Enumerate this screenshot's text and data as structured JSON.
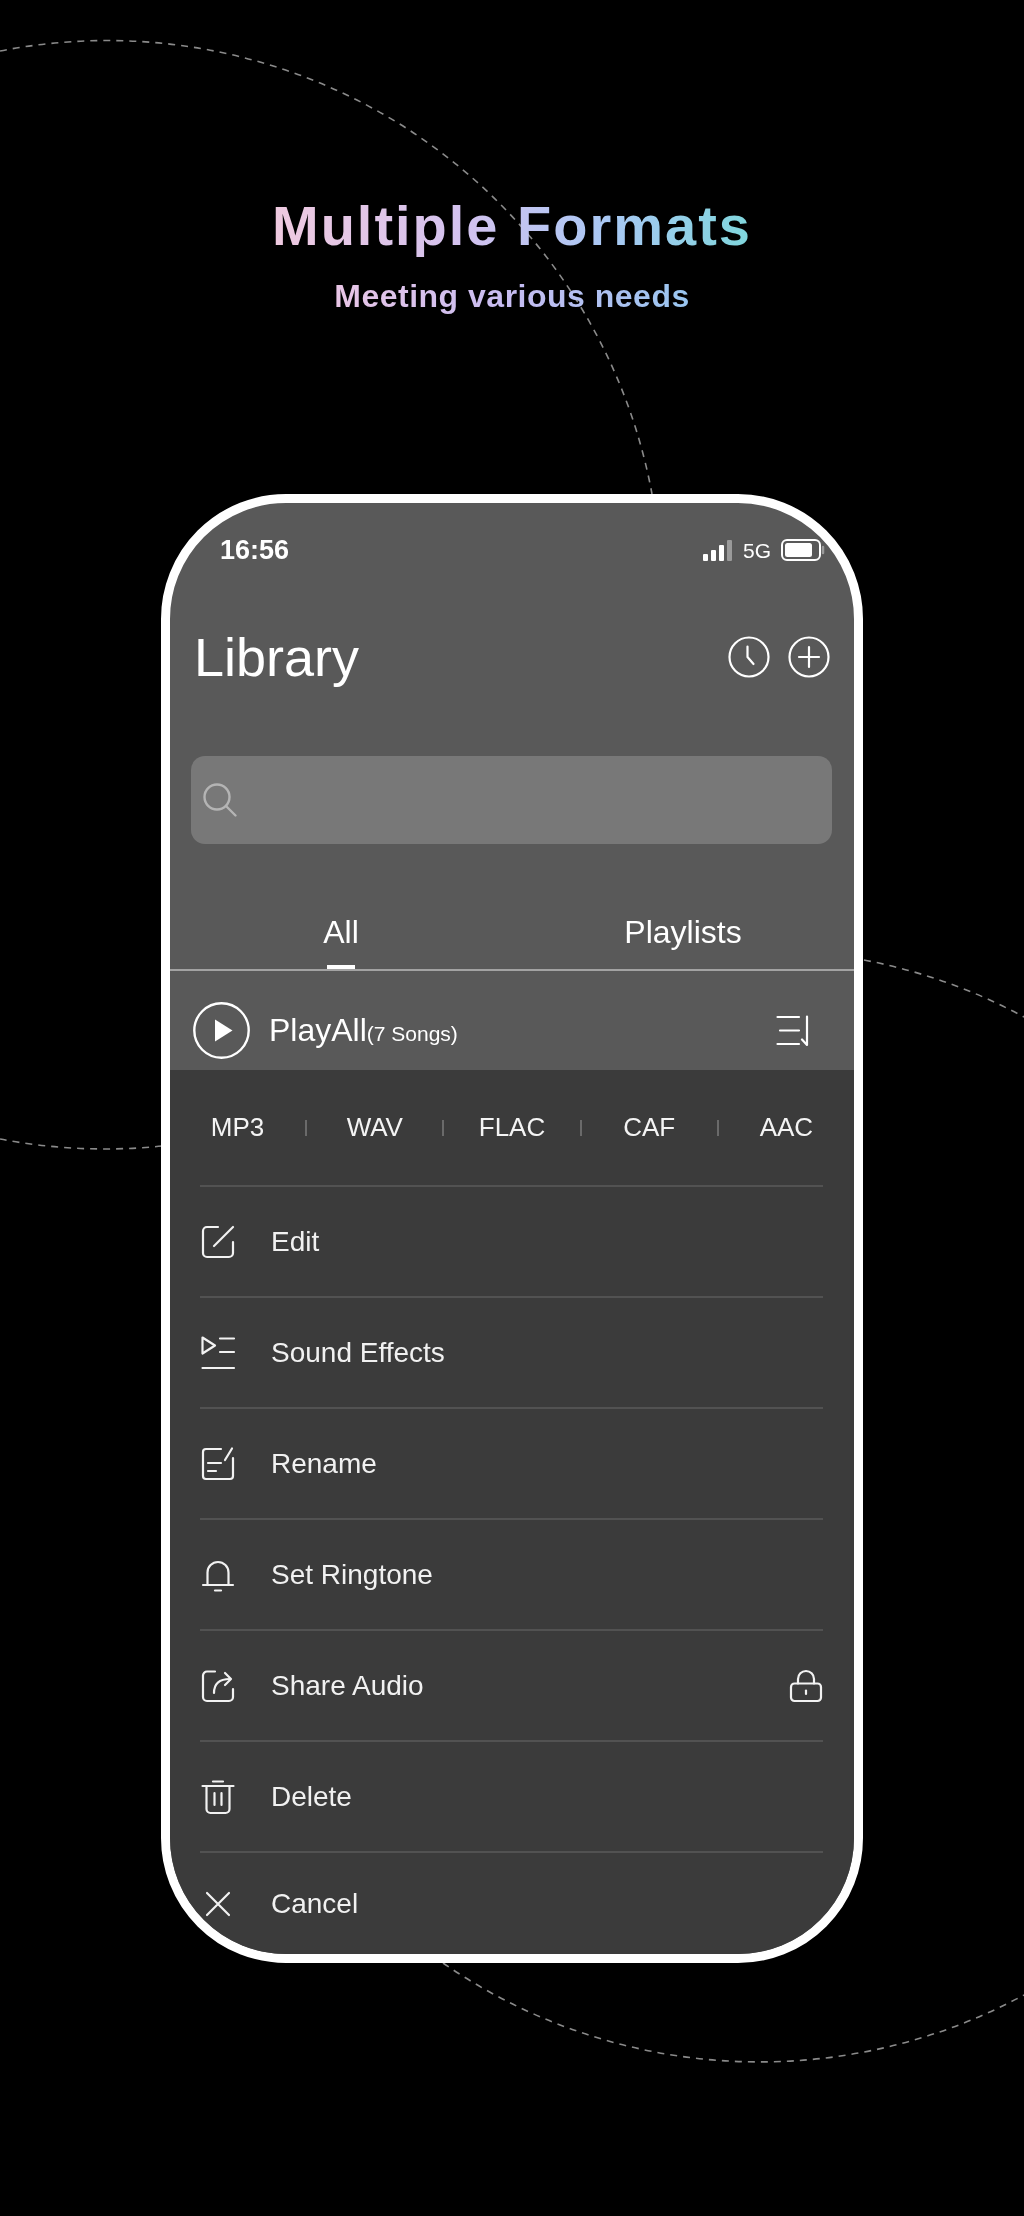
{
  "headline": {
    "title": "Multiple Formats",
    "subtitle": "Meeting various needs"
  },
  "status_bar": {
    "time": "16:56",
    "network": "5G"
  },
  "header": {
    "title": "Library"
  },
  "tabs": [
    {
      "label": "All",
      "selected": true
    },
    {
      "label": "Playlists",
      "selected": false
    }
  ],
  "play_all": {
    "label": "PlayAll",
    "count": "(7 Songs)"
  },
  "formats": [
    "MP3",
    "WAV",
    "FLAC",
    "CAF",
    "AAC"
  ],
  "actions": [
    {
      "kind": "edit",
      "label": "Edit",
      "locked": false
    },
    {
      "kind": "effects",
      "label": "Sound Effects",
      "locked": false
    },
    {
      "kind": "rename",
      "label": "Rename",
      "locked": false
    },
    {
      "kind": "ringtone",
      "label": "Set Ringtone",
      "locked": false
    },
    {
      "kind": "share",
      "label": "Share Audio",
      "locked": true
    },
    {
      "kind": "delete",
      "label": "Delete",
      "locked": false
    },
    {
      "kind": "cancel",
      "label": "Cancel",
      "locked": false
    }
  ]
}
